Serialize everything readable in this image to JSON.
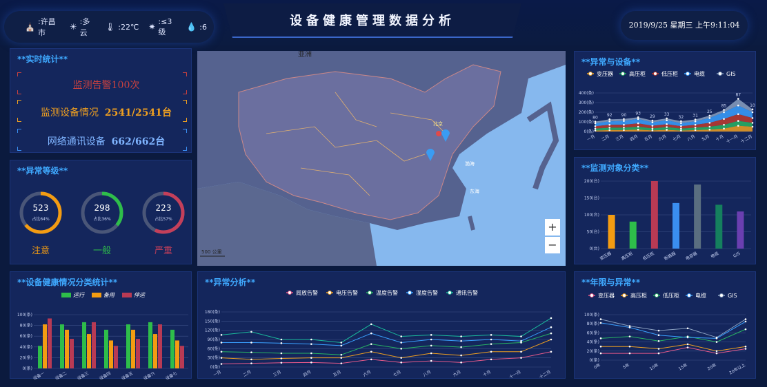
{
  "header": {
    "title": "设备健康管理数据分析",
    "clock": "2019/9/25 星期三 上午9:11:04",
    "weather": [
      {
        "icon": "location-icon",
        "glyph": "⛪",
        "text": ":许昌市"
      },
      {
        "icon": "sun-icon",
        "glyph": "☀",
        "text": ":多云"
      },
      {
        "icon": "thermometer-icon",
        "glyph": "🌡",
        "text": ":22℃"
      },
      {
        "icon": "wind-icon",
        "glyph": "✷",
        "text": ":≤3级"
      },
      {
        "icon": "drop-icon",
        "glyph": "💧",
        "text": ":6"
      }
    ]
  },
  "realtime": {
    "title": "**实时统计**",
    "alarm": "监测告警100次",
    "device_label": "监测设备情况",
    "device_value": "2541/2541台",
    "net_label": "网络通讯设备",
    "net_value": "662/662台",
    "colors": [
      "#c8413f",
      "#f0a020",
      "#3a8ef0"
    ]
  },
  "levels": {
    "title": "**异常等级**",
    "items": [
      {
        "value": "523",
        "pct": "占比64%",
        "fraction": 0.64,
        "label": "注意",
        "color": "#f39c12"
      },
      {
        "value": "298",
        "pct": "占比36%",
        "fraction": 0.36,
        "label": "一般",
        "color": "#2ebd4a"
      },
      {
        "value": "223",
        "pct": "占比57%",
        "fraction": 0.57,
        "label": "严重",
        "color": "#c43f5a"
      }
    ]
  },
  "map": {
    "labels": {
      "asia": "亚洲",
      "beijing": "北京",
      "bohai": "渤海",
      "donghai": "东海"
    },
    "scale": "500 公里",
    "zoom_in": "+",
    "zoom_out": "−"
  },
  "chart_data": [
    {
      "id": "abnormal_device",
      "type": "area",
      "title": "**异常与设备**",
      "categories": [
        "一月",
        "二月",
        "三月",
        "四月",
        "五月",
        "六月",
        "七月",
        "八月",
        "九月",
        "十月",
        "十一月",
        "十二月"
      ],
      "yticks": [
        "400(条)",
        "300(条)",
        "200(条)",
        "100(条)",
        "0(条)"
      ],
      "ylim": [
        0,
        400
      ],
      "series": [
        {
          "name": "变压器",
          "color": "#f0a020",
          "values": [
            10,
            15,
            15,
            20,
            12,
            18,
            10,
            15,
            20,
            30,
            60,
            50
          ]
        },
        {
          "name": "高压柜",
          "color": "#28b463",
          "values": [
            20,
            25,
            25,
            30,
            20,
            28,
            20,
            25,
            30,
            40,
            50,
            40
          ]
        },
        {
          "name": "低压柜",
          "color": "#c0392b",
          "values": [
            25,
            30,
            30,
            35,
            28,
            30,
            25,
            30,
            40,
            60,
            70,
            50
          ]
        },
        {
          "name": "电缆",
          "color": "#3aa0ff",
          "values": [
            30,
            35,
            40,
            45,
            35,
            40,
            32,
            35,
            50,
            70,
            90,
            60
          ]
        },
        {
          "name": "GIS",
          "color": "#8aa0c0",
          "values": [
            18,
            22,
            20,
            18,
            19,
            20,
            21,
            20,
            25,
            25,
            70,
            30
          ]
        }
      ],
      "top_labels": [
        "80",
        "92",
        "90",
        "93",
        "29",
        "33",
        "32",
        "31",
        "25",
        "85",
        "87",
        "10"
      ]
    },
    {
      "id": "monitor_class",
      "type": "bar",
      "title": "**监测对象分类**",
      "categories": [
        "变压器",
        "高压柜",
        "低压柜",
        "断路器",
        "电容器",
        "电缆",
        "GIS"
      ],
      "values": [
        100,
        80,
        200,
        135,
        190,
        130,
        110
      ],
      "colors": [
        "#f39c12",
        "#2ebd4a",
        "#b93a54",
        "#3a8ef0",
        "#5a6e80",
        "#15805e",
        "#6a3fb0"
      ],
      "yticks": [
        "200(台)",
        "150(台)",
        "100(台)",
        "50(台)",
        "0(台)"
      ],
      "ylim": [
        0,
        200
      ]
    },
    {
      "id": "health_class",
      "type": "bar",
      "title": "**设备健康情况分类统计**",
      "categories": [
        "设备一",
        "设备二",
        "设备三",
        "设备四",
        "设备五",
        "设备六",
        "设备七"
      ],
      "yticks": [
        "100(条)",
        "80(条)",
        "60(条)",
        "40(条)",
        "20(条)",
        "0(条)"
      ],
      "ylim": [
        0,
        100
      ],
      "series": [
        {
          "name": "运行",
          "color": "#2ebd4a",
          "values": [
            42,
            82,
            86,
            72,
            82,
            86,
            72
          ]
        },
        {
          "name": "备用",
          "color": "#f39c12",
          "values": [
            82,
            72,
            64,
            52,
            72,
            64,
            52
          ]
        },
        {
          "name": "停运",
          "color": "#b93a54",
          "values": [
            93,
            55,
            86,
            42,
            55,
            82,
            42
          ]
        }
      ]
    },
    {
      "id": "abnormal_analysis",
      "type": "line",
      "title": "**异常分析**",
      "categories": [
        "一月",
        "二月",
        "三月",
        "四月",
        "五月",
        "六月",
        "七月",
        "八月",
        "九月",
        "十月",
        "十一月",
        "十二月"
      ],
      "yticks": [
        "180(条)",
        "150(条)",
        "120(条)",
        "90(条)",
        "60(条)",
        "30(条)",
        "0(条)"
      ],
      "ylim": [
        0,
        180
      ],
      "series": [
        {
          "name": "局放告警",
          "color": "#e85a8a",
          "values": [
            10,
            12,
            14,
            15,
            12,
            25,
            15,
            20,
            15,
            25,
            30,
            50
          ]
        },
        {
          "name": "电压告警",
          "color": "#f0a020",
          "values": [
            30,
            25,
            28,
            30,
            30,
            50,
            30,
            45,
            38,
            50,
            50,
            90
          ]
        },
        {
          "name": "温度告警",
          "color": "#28b463",
          "values": [
            50,
            48,
            45,
            45,
            40,
            75,
            60,
            70,
            65,
            75,
            80,
            110
          ]
        },
        {
          "name": "湿度告警",
          "color": "#3aa0ff",
          "values": [
            80,
            80,
            78,
            75,
            70,
            110,
            80,
            90,
            85,
            90,
            85,
            130
          ]
        },
        {
          "name": "通讯告警",
          "color": "#1abc9c",
          "values": [
            105,
            115,
            90,
            90,
            80,
            140,
            100,
            105,
            100,
            105,
            100,
            160
          ]
        }
      ]
    },
    {
      "id": "years_abnormal",
      "type": "line",
      "title": "**年限与异常**",
      "categories": [
        "0年",
        "5年",
        "10年",
        "15年",
        "20年",
        "20年以上"
      ],
      "yticks": [
        "100(条)",
        "80(条)",
        "60(条)",
        "40(条)",
        "20(条)",
        "0(条)"
      ],
      "ylim": [
        0,
        100
      ],
      "series": [
        {
          "name": "变压器",
          "color": "#e85a8a",
          "values": [
            15,
            15,
            15,
            28,
            15,
            25
          ]
        },
        {
          "name": "高压柜",
          "color": "#f0a020",
          "values": [
            30,
            30,
            25,
            35,
            20,
            30
          ]
        },
        {
          "name": "低压柜",
          "color": "#28b463",
          "values": [
            48,
            52,
            42,
            52,
            40,
            68
          ]
        },
        {
          "name": "电缆",
          "color": "#3aa0ff",
          "values": [
            82,
            72,
            55,
            50,
            48,
            85
          ]
        },
        {
          "name": "GIS",
          "color": "#8aa0c0",
          "values": [
            90,
            75,
            65,
            70,
            50,
            90
          ]
        }
      ]
    }
  ]
}
